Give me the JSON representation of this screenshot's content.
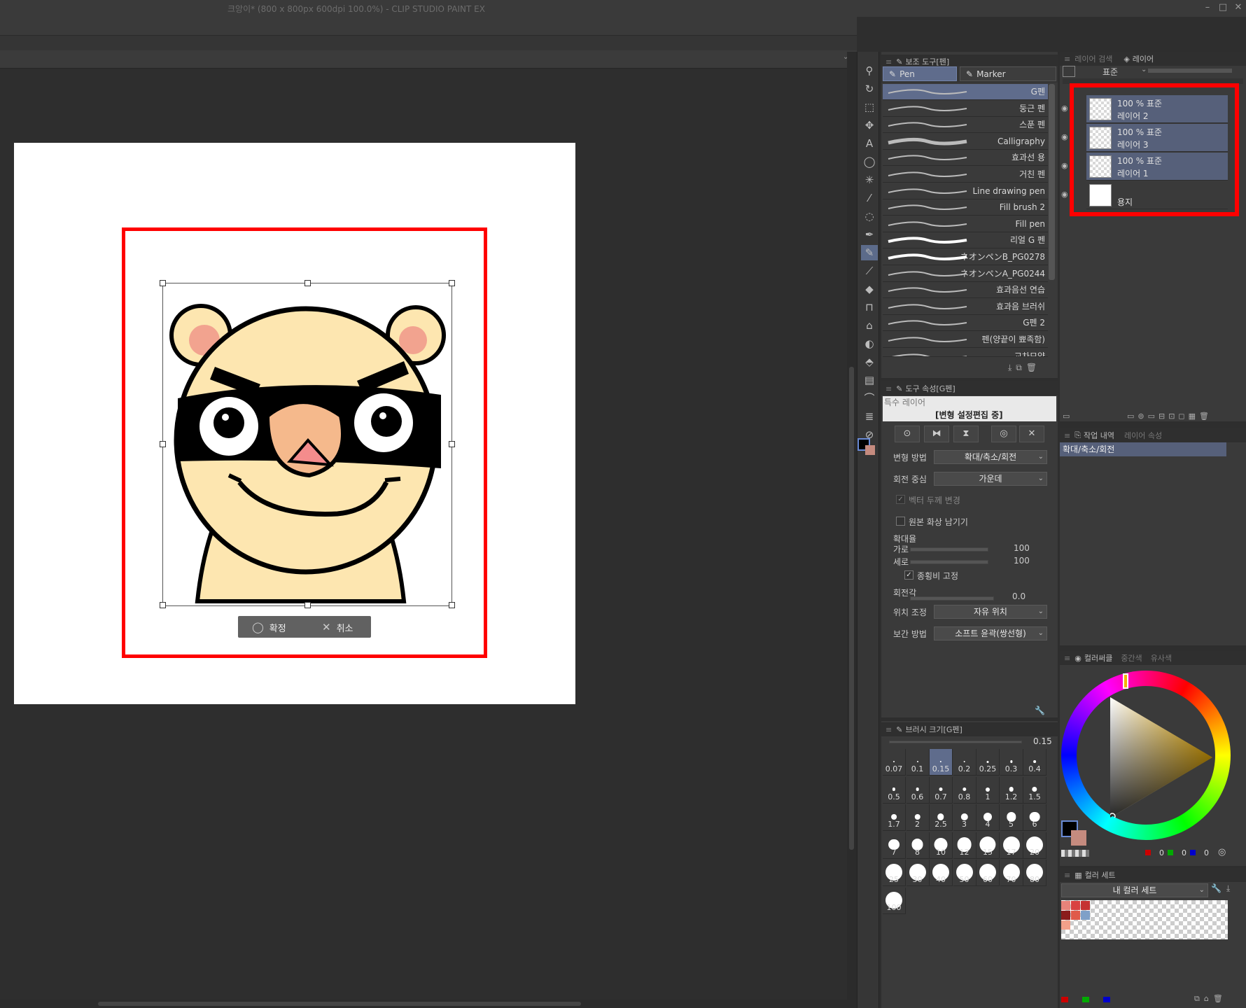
{
  "window": {
    "title": "크앙이* (800 x 800px 600dpi 100.0%)  - CLIP STUDIO PAINT EX",
    "minimize": "–",
    "maximize": "□",
    "close": "✕"
  },
  "canvas": {
    "confirm_label": "확정",
    "cancel_label": "취소"
  },
  "tools": [
    {
      "name": "zoom-icon",
      "glyph": "⚲"
    },
    {
      "name": "rotate-view-icon",
      "glyph": "↻"
    },
    {
      "name": "object-icon",
      "glyph": "⬚"
    },
    {
      "name": "move-layer-icon",
      "glyph": "✥"
    },
    {
      "name": "text-icon",
      "glyph": "A"
    },
    {
      "name": "speech-balloon-icon",
      "glyph": "◯"
    },
    {
      "name": "auto-select-icon",
      "glyph": "✳"
    },
    {
      "name": "eyedropper-icon",
      "glyph": "⁄"
    },
    {
      "name": "lasso-icon",
      "glyph": "◌"
    },
    {
      "name": "fountain-pen-icon",
      "glyph": "✒"
    },
    {
      "name": "pen-icon",
      "glyph": "✎"
    },
    {
      "name": "brush-icon",
      "glyph": "⟋"
    },
    {
      "name": "eraser-icon",
      "glyph": "◆"
    },
    {
      "name": "airbrush-icon",
      "glyph": "⊓"
    },
    {
      "name": "decoration-icon",
      "glyph": "⌂"
    },
    {
      "name": "blend-icon",
      "glyph": "◐"
    },
    {
      "name": "fill-icon",
      "glyph": "⬘"
    },
    {
      "name": "gradient-icon",
      "glyph": "▤"
    },
    {
      "name": "figure-icon",
      "glyph": "⌒"
    },
    {
      "name": "frame-border-icon",
      "glyph": "≣"
    },
    {
      "name": "ruler-icon",
      "glyph": "⊘"
    }
  ],
  "subtool": {
    "header": "보조 도구[펜]",
    "tabs": [
      "Pen",
      "Marker"
    ],
    "brushes": [
      "G펜",
      "둥근 펜",
      "스푼 펜",
      "Calligraphy",
      "효과선 용",
      "거친 펜",
      "Line drawing pen",
      "Fill brush 2",
      "Fill pen",
      "리얼 G 펜",
      "ネオンペンB_PG0278",
      "ネオンペンA_PG0244",
      "효과음선 연습",
      "효과음 브러쉬",
      "G펜 2",
      "펜(양끝이 뾰족함)",
      "교차모양"
    ]
  },
  "toolprop": {
    "header": "도구 속성[G펜]",
    "banner_top": "특수 레이어",
    "banner_main": "[변형 설정편집 중]",
    "transform_method_label": "변형 방법",
    "transform_method_value": "확대/축소/회전",
    "rotation_center_label": "회전 중심",
    "rotation_center_value": "가운데",
    "vector_thickness_label": "벡터 두께 변경",
    "keep_original_label": "원본 화상 남기기",
    "scale_label": "확대율",
    "width_label": "가로",
    "width_value": "100",
    "height_label": "세로",
    "height_value": "100",
    "keep_ratio_label": "종횡비 고정",
    "rotation_label": "회전각",
    "rotation_value": "0.0",
    "position_label": "위치 조정",
    "position_value": "자유 위치",
    "interp_label": "보간 방법",
    "interp_value": "소프트 윤곽(쌍선형)"
  },
  "brushsize": {
    "header": "브러시 크기[G펜]",
    "current": "0.15",
    "sizes": [
      "0.07",
      "0.1",
      "0.15",
      "0.2",
      "0.25",
      "0.3",
      "0.4",
      "0.5",
      "0.6",
      "0.7",
      "0.8",
      "1",
      "1.2",
      "1.5",
      "1.7",
      "2",
      "2.5",
      "3",
      "4",
      "5",
      "6",
      "7",
      "8",
      "10",
      "12",
      "15",
      "17",
      "20",
      "25",
      "30",
      "40",
      "50",
      "60",
      "70",
      "80",
      "100"
    ]
  },
  "layers": {
    "tab_search": "레이어 검색",
    "tab_layer": "레이어",
    "blend_mode": "표준",
    "items": [
      {
        "mode": "100 % 표준",
        "name": "레이어 2",
        "selected": true
      },
      {
        "mode": "100 % 표준",
        "name": "레이어 3",
        "selected": true
      },
      {
        "mode": "100 % 표준",
        "name": "레이어 1",
        "selected": true
      },
      {
        "mode": "",
        "name": "용지",
        "selected": false
      }
    ]
  },
  "history": {
    "tab_history": "작업 내역",
    "tab_props": "레이어 속성",
    "entry": "확대/축소/회전"
  },
  "colorwheel": {
    "tab_wheel": "컬러써클",
    "tab_mid": "중간색",
    "tab_similar": "유사색",
    "r": "0",
    "g": "0",
    "b": "0"
  },
  "colorset": {
    "header": "컬러 세트",
    "set_name": "내 컬러 세트",
    "swatches": [
      "#e8837a",
      "#d94141",
      "#c53232",
      "#8b1c1c",
      "#e05a4a",
      "#7fa0c8",
      "#f2a08a"
    ]
  }
}
